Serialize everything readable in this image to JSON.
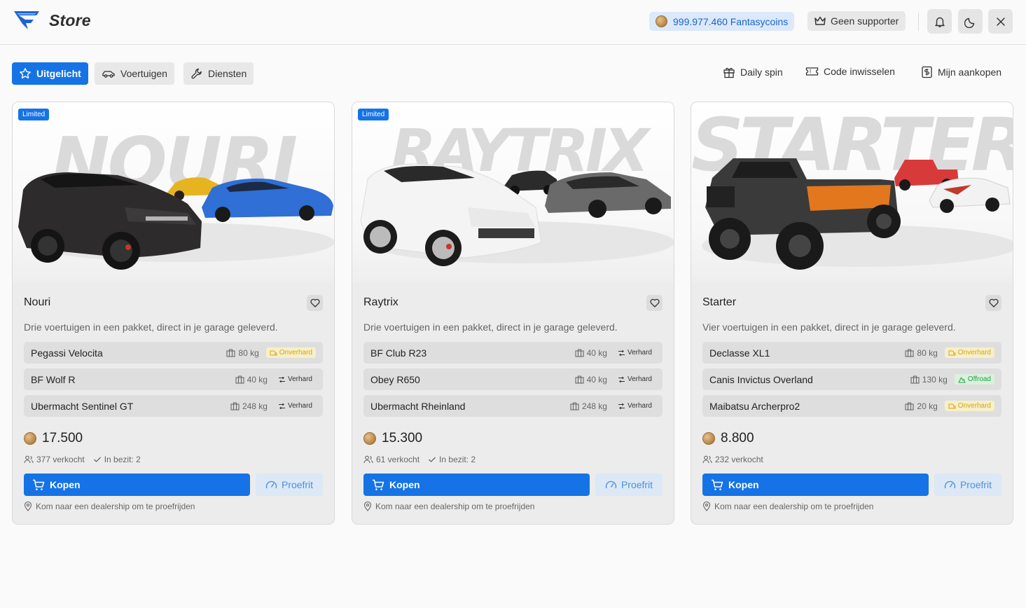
{
  "header": {
    "title": "Store",
    "coins_label": "999.977.460 Fantasycoins",
    "supporter_label": "Geen supporter",
    "icons": [
      "bell-icon",
      "moon-icon",
      "close-icon"
    ]
  },
  "tabs": [
    {
      "label": "Uitgelicht",
      "icon": "star-icon",
      "active": true
    },
    {
      "label": "Voertuigen",
      "icon": "car-icon",
      "active": false
    },
    {
      "label": "Diensten",
      "icon": "wrench-icon",
      "active": false
    }
  ],
  "actions": [
    {
      "label": "Daily spin",
      "icon": "gift-icon"
    },
    {
      "label": "Code inwisselen",
      "icon": "ticket-icon"
    },
    {
      "label": "Mijn aankopen",
      "icon": "receipt-icon"
    }
  ],
  "cards": [
    {
      "watermark": "NOURI",
      "badge": "Limited",
      "name": "Nouri",
      "description": "Drie voertuigen in een pakket, direct in je garage geleverd.",
      "vehicles": [
        {
          "name": "Pegassi Velocita",
          "weight": "80 kg",
          "terrain": "Onverhard"
        },
        {
          "name": "BF Wolf R",
          "weight": "40 kg",
          "terrain": "Verhard"
        },
        {
          "name": "Ubermacht Sentinel GT",
          "weight": "248 kg",
          "terrain": "Verhard"
        }
      ],
      "price": "17.500",
      "sold": "377 verkocht",
      "owned": "In bezit: 2",
      "buy_label": "Kopen",
      "try_label": "Proefrit",
      "dealer_note": "Kom naar een dealership om te proefrijden"
    },
    {
      "watermark": "RAYTRIX",
      "badge": "Limited",
      "name": "Raytrix",
      "description": "Drie voertuigen in een pakket, direct in je garage geleverd.",
      "vehicles": [
        {
          "name": "BF Club R23",
          "weight": "40 kg",
          "terrain": "Verhard"
        },
        {
          "name": "Obey R650",
          "weight": "40 kg",
          "terrain": "Verhard"
        },
        {
          "name": "Ubermacht Rheinland",
          "weight": "248 kg",
          "terrain": "Verhard"
        }
      ],
      "price": "15.300",
      "sold": "61 verkocht",
      "owned": "In bezit: 2",
      "buy_label": "Kopen",
      "try_label": "Proefrit",
      "dealer_note": "Kom naar een dealership om te proefrijden"
    },
    {
      "watermark": "STARTER",
      "badge": "",
      "name": "Starter",
      "description": "Vier voertuigen in een pakket, direct in je garage geleverd.",
      "vehicles": [
        {
          "name": "Declasse XL1",
          "weight": "80 kg",
          "terrain": "Onverhard"
        },
        {
          "name": "Canis Invictus Overland",
          "weight": "130 kg",
          "terrain": "Offroad"
        },
        {
          "name": "Maibatsu Archerpro2",
          "weight": "20 kg",
          "terrain": "Onverhard"
        }
      ],
      "price": "8.800",
      "sold": "232 verkocht",
      "owned": "",
      "buy_label": "Kopen",
      "try_label": "Proefrit",
      "dealer_note": "Kom naar een dealership om te proefrijden"
    }
  ]
}
